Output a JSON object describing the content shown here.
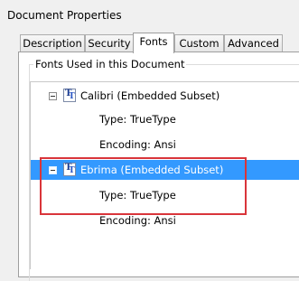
{
  "window": {
    "title": "Document Properties"
  },
  "tabs": [
    {
      "label": "Description"
    },
    {
      "label": "Security"
    },
    {
      "label": "Fonts"
    },
    {
      "label": "Custom"
    },
    {
      "label": "Advanced"
    }
  ],
  "fonts_group": {
    "label": "Fonts Used in this Document"
  },
  "fonts": [
    {
      "name": "Calibri (Embedded Subset)",
      "type": "Type: TrueType",
      "encoding": "Encoding: Ansi",
      "selected": false
    },
    {
      "name": "Ebrima (Embedded Subset)",
      "type": "Type: TrueType",
      "encoding": "Encoding: Ansi",
      "selected": true
    }
  ],
  "colors": {
    "selection": "#3399ff",
    "highlight_box": "#d9353a"
  }
}
